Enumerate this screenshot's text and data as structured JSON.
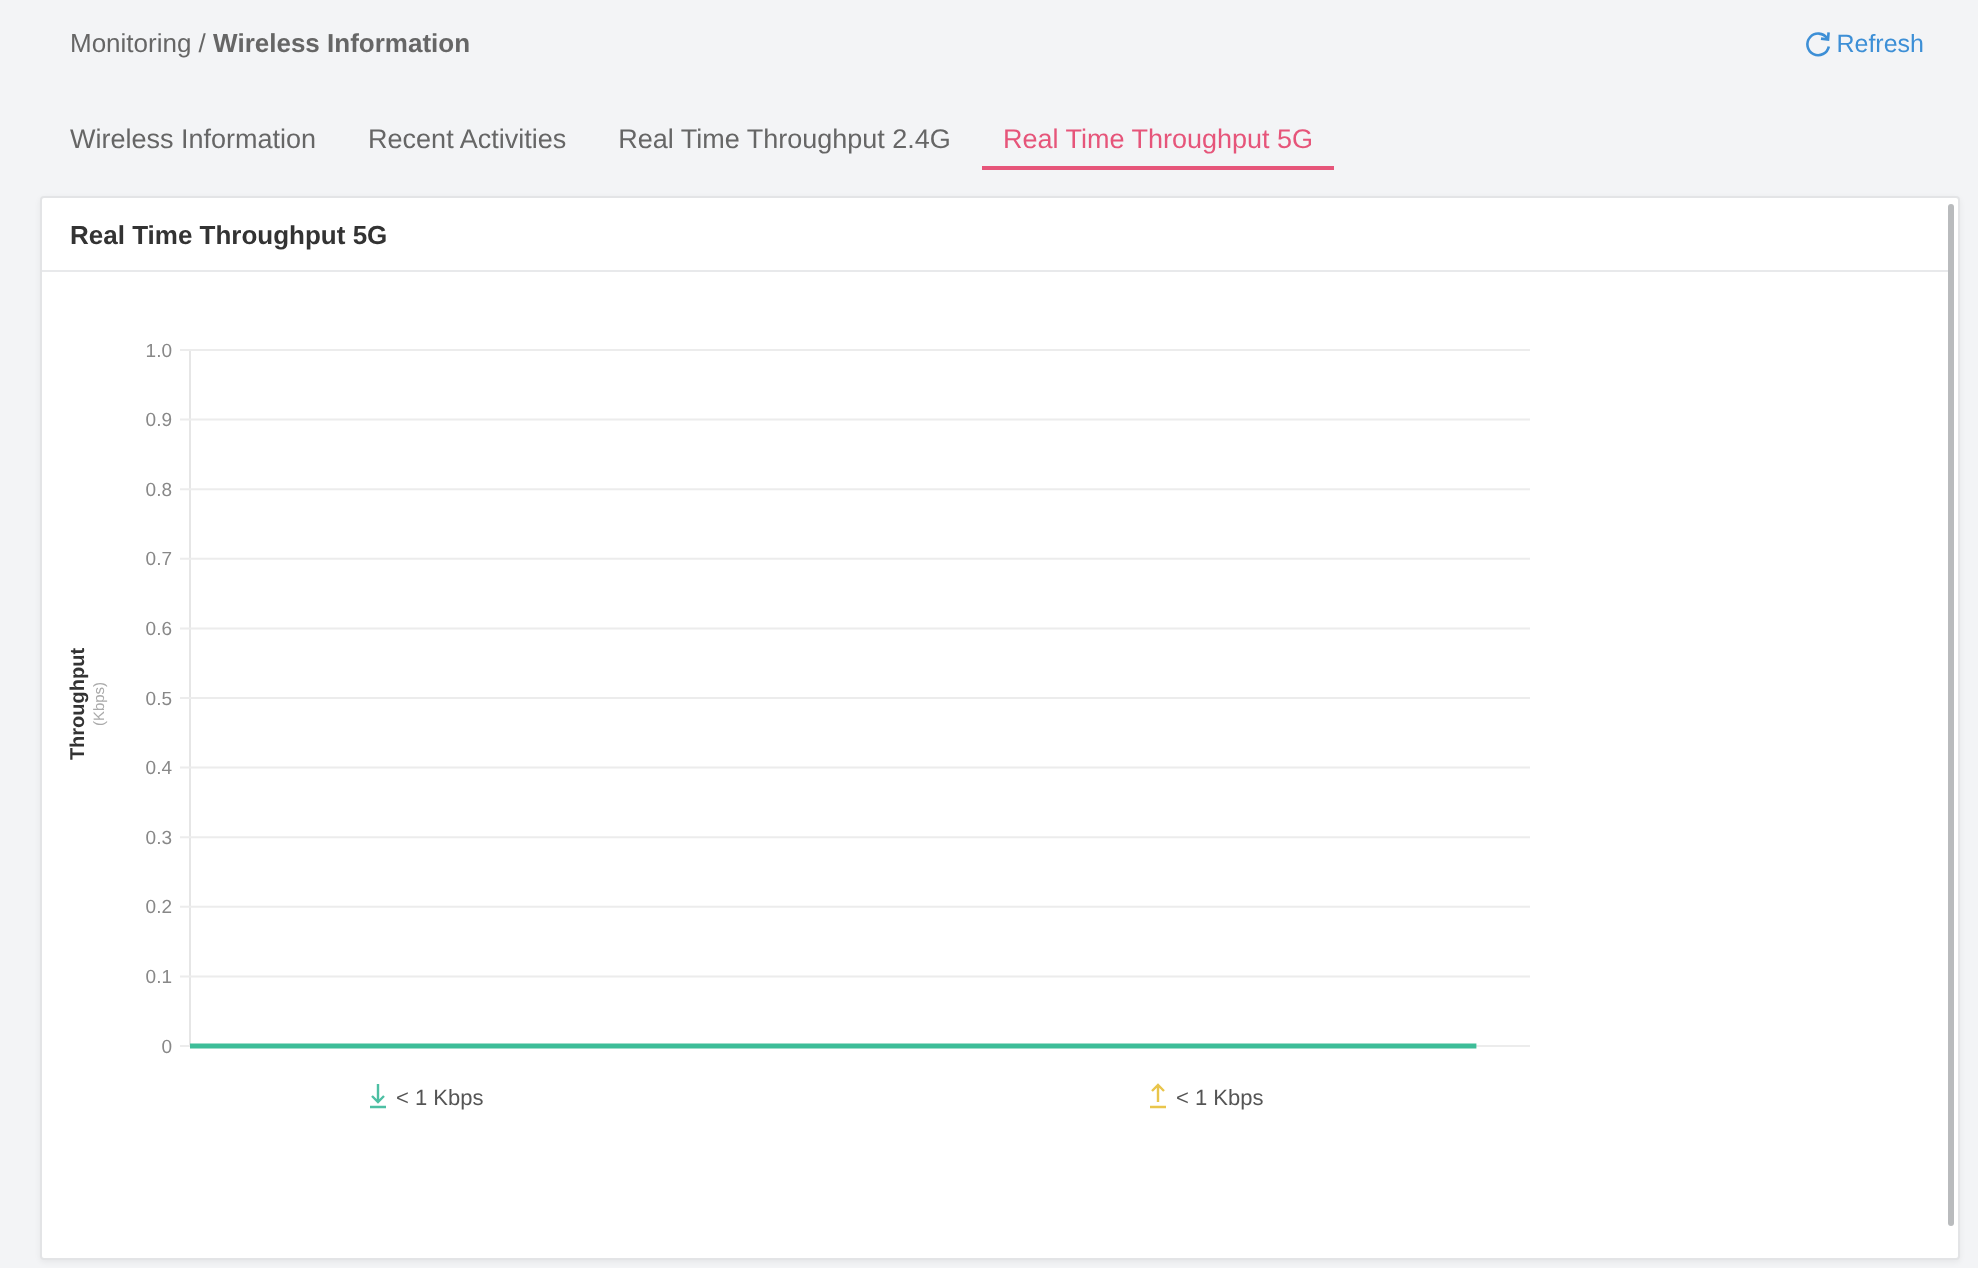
{
  "header": {
    "breadcrumb": "Monitoring / **Wireless Information**",
    "refresh": "Refresh"
  },
  "tabs": [
    {
      "label": "Wireless Information",
      "selected": false
    },
    {
      "label": "Recent Activities",
      "selected": false
    },
    {
      "label": "Real Time Throughput 2.4G",
      "selected": false
    },
    {
      "label": "Real Time Throughput 5G",
      "selected": true
    }
  ],
  "panel": {
    "title": "Real Time Throughput 5G",
    "y_unit": "(Kbps)",
    "chart_data": {
      "type": "line",
      "ylabel": "Throughput",
      "ylim": [
        0,
        1
      ],
      "yticks": [
        0,
        0.1,
        0.2,
        0.3,
        0.4,
        0.5,
        0.6,
        0.7,
        0.8,
        0.9,
        {
          "value": 1,
          "label": "1.0"
        }
      ],
      "grid": true,
      "series": [
        {
          "color": "#3dbd98",
          "values": [
            0,
            0,
            0,
            0,
            0,
            0,
            0,
            0,
            0,
            0
          ]
        }
      ]
    },
    "legend": [
      {
        "kind": "download",
        "color": "#4dbfa3",
        "text": "< 1 Kbps"
      },
      {
        "kind": "upload",
        "color": "#e9c54b",
        "text": "< 1 Kbps"
      }
    ]
  }
}
